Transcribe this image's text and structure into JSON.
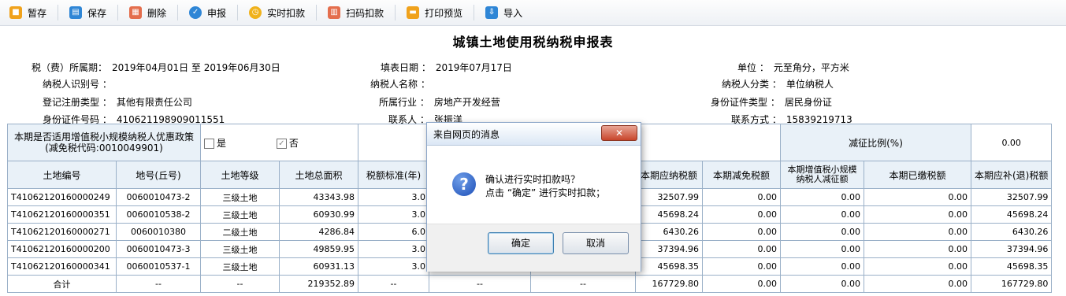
{
  "toolbar": {
    "items": [
      {
        "label": "暂存",
        "icon": "temp-save-icon",
        "color": "#f0a21c"
      },
      {
        "label": "保存",
        "icon": "save-icon",
        "color": "#2f86d6"
      },
      {
        "label": "删除",
        "icon": "delete-icon",
        "color": "#e46e4d"
      },
      {
        "label": "申报",
        "icon": "declare-icon",
        "color": "#2f86d6"
      },
      {
        "label": "实时扣款",
        "icon": "clock-icon",
        "color": "#f0b21c"
      },
      {
        "label": "扫码扣款",
        "icon": "scan-icon",
        "color": "#e46e4d"
      },
      {
        "label": "打印预览",
        "icon": "print-icon",
        "color": "#f0a21c"
      },
      {
        "label": "导入",
        "icon": "import-icon",
        "color": "#2f86d6"
      }
    ]
  },
  "form": {
    "title": "城镇土地使用税纳税申报表",
    "period_label": "税（费）所属期：",
    "period_value": "2019年04月01日 至 2019年06月30日",
    "fill_date_label": "填表日期 ：",
    "fill_date_value": "2019年07月17日",
    "unit_label": "单位 ：",
    "unit_value": "元至角分，平方米",
    "taxpayer_id_label": "纳税人识别号 ：",
    "taxpayer_id_value": "",
    "taxpayer_name_label": "纳税人名称 ：",
    "taxpayer_name_value": "",
    "taxpayer_type_label": "纳税人分类 ：",
    "taxpayer_type_value": "单位纳税人",
    "reg_type_label": "登记注册类型 ：",
    "reg_type_value": "其他有限责任公司",
    "industry_label": "所属行业 ：",
    "industry_value": "房地产开发经营",
    "id_type_label": "身份证件类型 ：",
    "id_type_value": "居民身份证",
    "id_no_label": "身份证件号码 ：",
    "id_no_value": "410621198909011551",
    "contact_label": "联系人 ：",
    "contact_value": "张振洋",
    "phone_label": "联系方式 ：",
    "phone_value": "15839219713"
  },
  "policy": {
    "question": "本期是否适用增值税小规模纳税人优惠政策(减免税代码:0010049901)",
    "yes_label": "是",
    "no_label": "否",
    "ratio_label": "减征比例(%)",
    "ratio_value": "0.00"
  },
  "table": {
    "headers": [
      "土地编号",
      "地号(丘号)",
      "土地等级",
      "土地总面积",
      "税额标准(年)",
      "",
      "",
      "本期应纳税额",
      "本期减免税额",
      "本期增值税小规模纳税人减征额",
      "本期已缴税额",
      "本期应补(退)税额"
    ],
    "rows": [
      [
        "T41062120160000249",
        "0060010473-2",
        "三级土地",
        "43343.98",
        "3.0",
        "",
        "",
        "32507.99",
        "0.00",
        "0.00",
        "0.00",
        "32507.99"
      ],
      [
        "T41062120160000351",
        "0060010538-2",
        "三级土地",
        "60930.99",
        "3.0",
        "",
        "",
        "45698.24",
        "0.00",
        "0.00",
        "0.00",
        "45698.24"
      ],
      [
        "T41062120160000271",
        "0060010380",
        "二级土地",
        "4286.84",
        "6.0",
        "",
        "",
        "6430.26",
        "0.00",
        "0.00",
        "0.00",
        "6430.26"
      ],
      [
        "T41062120160000200",
        "0060010473-3",
        "三级土地",
        "49859.95",
        "3.0",
        "",
        "",
        "37394.96",
        "0.00",
        "0.00",
        "0.00",
        "37394.96"
      ],
      [
        "T41062120160000341",
        "0060010537-1",
        "三级土地",
        "60931.13",
        "3.0",
        "",
        "",
        "45698.35",
        "0.00",
        "0.00",
        "0.00",
        "45698.35"
      ]
    ],
    "total": [
      "合计",
      "--",
      "--",
      "219352.89",
      "--",
      "--",
      "--",
      "167729.80",
      "0.00",
      "0.00",
      "0.00",
      "167729.80"
    ]
  },
  "dialog": {
    "title": "来自网页的消息",
    "close": "✕",
    "line1": "确认进行实时扣款吗？",
    "line2": "点击 “确定” 进行实时扣款；",
    "ok": "确定",
    "cancel": "取消"
  }
}
